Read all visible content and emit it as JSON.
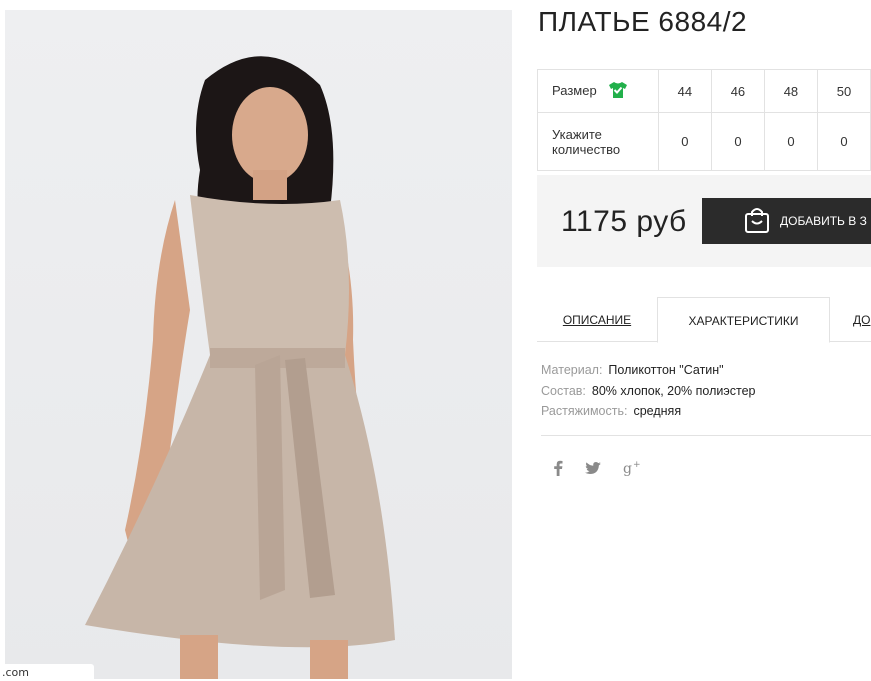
{
  "product": {
    "title": "ПЛАТЬЕ 6884/2",
    "image_alt": "Женщина в атласном платье бежевого цвета с поясом"
  },
  "url_fragment": ".com",
  "size_table": {
    "size_label": "Размер",
    "qty_label": "Укажите количество",
    "sizes": [
      "44",
      "46",
      "48",
      "50"
    ],
    "quantities": [
      "0",
      "0",
      "0",
      "0"
    ],
    "icon": "tshirt-check-icon",
    "icon_color": "#22b04b"
  },
  "price": "1175 руб",
  "cart_button": {
    "label": "ДОБАВИТЬ В З",
    "icon": "shopping-bag-icon"
  },
  "tabs": [
    {
      "label": "ОПИСАНИЕ",
      "active": false
    },
    {
      "label": "ХАРАКТЕРИСТИКИ",
      "active": true
    },
    {
      "label": "ДО",
      "active": false
    }
  ],
  "specs": [
    {
      "key": "Материал:",
      "value": "Поликоттон \"Сатин\""
    },
    {
      "key": "Состав:",
      "value": "80% хлопок, 20% полиэстер"
    },
    {
      "key": "Растяжимость:",
      "value": "средняя"
    }
  ],
  "social": [
    {
      "name": "facebook-icon",
      "glyph": "f"
    },
    {
      "name": "twitter-icon",
      "glyph": "🐦"
    },
    {
      "name": "google-plus-icon",
      "glyph": "g+"
    }
  ],
  "colors": {
    "dark_button": "#2b2b2b",
    "price_bg": "#f4f4f4",
    "dress": "#c9b9ab"
  }
}
